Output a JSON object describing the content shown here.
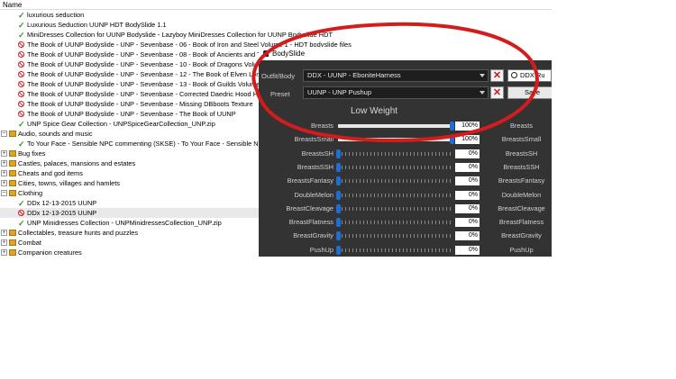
{
  "tree": {
    "header": "Name",
    "rows": [
      {
        "level": 2,
        "status": "check",
        "text": "luxurious seduction"
      },
      {
        "level": 2,
        "status": "check",
        "text": "Luxurious Seduction UUNP HDT BodySlide 1.1"
      },
      {
        "level": 2,
        "status": "check",
        "text": "MiniDresses Collection for UUNP Bodyslide - Lazyboy MiniDresses Collection for UUNP Bodyslide HDT"
      },
      {
        "level": 2,
        "status": "ban",
        "text": "The Book of UUNP Bodyslide - UNP - Sevenbase - 06 - Book of Iron and Steel Volume 1 - HDT bodyslide files"
      },
      {
        "level": 2,
        "status": "ban",
        "text": "The Book of UUNP Bodyslide - UNP - Sevenbase - 08 - Book of Ancients and Tribal"
      },
      {
        "level": 2,
        "status": "ban",
        "text": "The Book of UUNP Bodyslide - UNP - Sevenbase - 10 - Book of Dragons Volume 3"
      },
      {
        "level": 2,
        "status": "ban",
        "text": "The Book of UUNP Bodyslide - UNP - Sevenbase - 12 - The Book of Elven Lords V"
      },
      {
        "level": 2,
        "status": "ban",
        "text": "The Book of UUNP Bodyslide - UNP - Sevenbase - 13 - Book of Guilds Volume 5 -"
      },
      {
        "level": 2,
        "status": "ban",
        "text": "The Book of UUNP Bodyslide - UNP - Sevenbase - Corrected Daedric Hood Hair U"
      },
      {
        "level": 2,
        "status": "ban",
        "text": "The Book of UUNP Bodyslide - UNP - Sevenbase - Missing DBboots Texture"
      },
      {
        "level": 2,
        "status": "ban",
        "text": "The Book of UUNP Bodyslide - UNP - Sevenbase - The Book of UUNP"
      },
      {
        "level": 2,
        "status": "check",
        "text": "UNP Spice Gear Collection - UNPSpiceGearCollection_UNP.zip"
      },
      {
        "level": 1,
        "status": "folder-open",
        "text": "Audio, sounds and music"
      },
      {
        "level": 2,
        "status": "check",
        "text": "To Your Face - Sensible NPC commenting (SKSE) - To Your Face - Sensible NPC co"
      },
      {
        "level": 1,
        "status": "folder",
        "text": "Bug fixes"
      },
      {
        "level": 1,
        "status": "folder",
        "text": "Castles, palaces, mansions and estates"
      },
      {
        "level": 1,
        "status": "folder",
        "text": "Cheats and god items"
      },
      {
        "level": 1,
        "status": "folder",
        "text": "Cities, towns, villages and hamlets"
      },
      {
        "level": 1,
        "status": "folder-open",
        "text": "Clothing"
      },
      {
        "level": 2,
        "status": "check",
        "text": "DDx 12-13-2015 UUNP"
      },
      {
        "level": 2,
        "status": "ban",
        "text": "DDx 12-13-2015 UUNP",
        "selected": true
      },
      {
        "level": 2,
        "status": "check",
        "text": "UNP Minidresses Collection - UNPMinidressesCollection_UNP.zip"
      },
      {
        "level": 1,
        "status": "folder",
        "text": "Collectables, treasure hunts and puzzles"
      },
      {
        "level": 1,
        "status": "folder",
        "text": "Combat"
      },
      {
        "level": 1,
        "status": "folder",
        "text": "Companion creatures"
      }
    ]
  },
  "bodyslide": {
    "title": "BodySlide",
    "outfit_label": "Outfit/Body",
    "outfit_value": "DDX - UUNP - EboniteHarness",
    "preset_label": "Preset",
    "preset_value": "UUNP - UNP Pushup",
    "search_value": "DDX Ru",
    "save_label": "Save",
    "clear_symbol": "✕",
    "weight_heading": "Low Weight",
    "sliders": [
      {
        "name": "Breasts",
        "value": 100,
        "display": "100%"
      },
      {
        "name": "BreastsSmall",
        "value": 100,
        "display": "100%"
      },
      {
        "name": "BreastsSH",
        "value": 0,
        "display": "0%"
      },
      {
        "name": "BreastsSSH",
        "value": 0,
        "display": "0%"
      },
      {
        "name": "BreastsFantasy",
        "value": 0,
        "display": "0%"
      },
      {
        "name": "DoubleMelon",
        "value": 0,
        "display": "0%"
      },
      {
        "name": "BreastCleavage",
        "value": 0,
        "display": "0%"
      },
      {
        "name": "BreastFlatness",
        "value": 0,
        "display": "0%"
      },
      {
        "name": "BreastGravity",
        "value": 0,
        "display": "0%"
      },
      {
        "name": "PushUp",
        "value": 0,
        "display": "0%"
      }
    ]
  },
  "colors": {
    "annotation": "#d41c1c",
    "thumb": "#1d6fd8",
    "check": "#2f9a2f",
    "ban": "#cc2222"
  }
}
